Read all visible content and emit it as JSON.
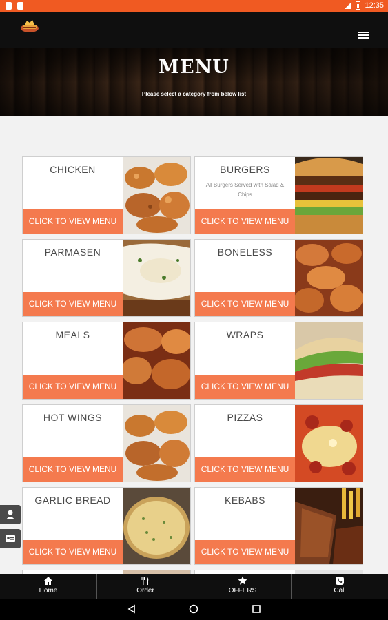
{
  "status_bar": {
    "time": "12:35"
  },
  "header": {
    "logo_icon": "restaurant-logo-icon",
    "menu_icon": "hamburger-icon"
  },
  "banner": {
    "title": "MENU",
    "subtitle": "Please select a category from below list"
  },
  "categories": [
    {
      "title": "CHICKEN",
      "subtitle": "",
      "button": "CLICK TO VIEW MENU",
      "image": "fried-chicken-image"
    },
    {
      "title": "BURGERS",
      "subtitle": "All Burgers Served with Salad & Chips",
      "button": "CLICK TO VIEW MENU",
      "image": "burger-image"
    },
    {
      "title": "PARMASEN",
      "subtitle": "",
      "button": "CLICK TO VIEW MENU",
      "image": "parmesan-image"
    },
    {
      "title": "BONELESS",
      "subtitle": "",
      "button": "CLICK TO VIEW MENU",
      "image": "boneless-chicken-image"
    },
    {
      "title": "MEALS",
      "subtitle": "",
      "button": "CLICK TO VIEW MENU",
      "image": "meals-image"
    },
    {
      "title": "WRAPS",
      "subtitle": "",
      "button": "CLICK TO VIEW MENU",
      "image": "wraps-image"
    },
    {
      "title": "HOT WINGS",
      "subtitle": "",
      "button": "CLICK TO VIEW MENU",
      "image": "hot-wings-image"
    },
    {
      "title": "PIZZAS",
      "subtitle": "",
      "button": "CLICK TO VIEW MENU",
      "image": "pizza-image"
    },
    {
      "title": "GARLIC BREAD",
      "subtitle": "",
      "button": "CLICK TO VIEW MENU",
      "image": "garlic-bread-image"
    },
    {
      "title": "KEBABS",
      "subtitle": "",
      "button": "CLICK TO VIEW MENU",
      "image": "kebab-image"
    }
  ],
  "side_buttons": [
    "user-icon",
    "contact-card-icon"
  ],
  "bottom_nav": [
    {
      "label": "Home",
      "icon": "home-icon"
    },
    {
      "label": "Order",
      "icon": "cutlery-icon"
    },
    {
      "label": "OFFERS",
      "icon": "star-icon"
    },
    {
      "label": "Call",
      "icon": "phone-icon"
    }
  ],
  "colors": {
    "status_bar": "#f05a22",
    "button": "#f47a4e",
    "nav_bg": "#0f0f0f"
  }
}
